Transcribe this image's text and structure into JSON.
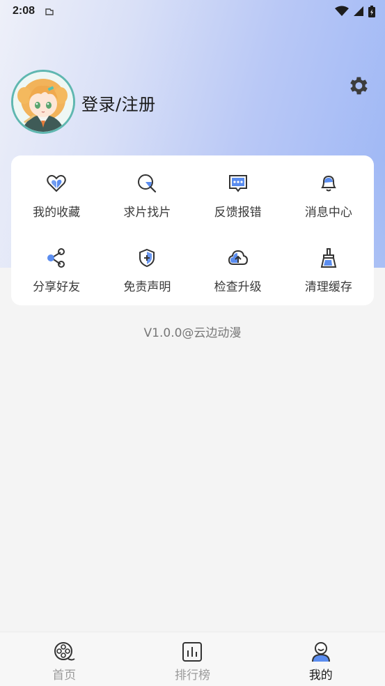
{
  "status_bar": {
    "time": "2:08"
  },
  "profile": {
    "login_label": "登录/注册"
  },
  "features": [
    {
      "label": "我的收藏",
      "icon": "heart-icon"
    },
    {
      "label": "求片找片",
      "icon": "search-film-icon"
    },
    {
      "label": "反馈报错",
      "icon": "feedback-icon"
    },
    {
      "label": "消息中心",
      "icon": "bell-icon"
    },
    {
      "label": "分享好友",
      "icon": "share-icon"
    },
    {
      "label": "免责声明",
      "icon": "shield-icon"
    },
    {
      "label": "检查升级",
      "icon": "cloud-upload-icon"
    },
    {
      "label": "清理缓存",
      "icon": "broom-icon"
    }
  ],
  "version": "V1.0.0@云边动漫",
  "tabs": [
    {
      "label": "首页",
      "icon": "film-reel-icon",
      "active": false
    },
    {
      "label": "排行榜",
      "icon": "bar-chart-icon",
      "active": false
    },
    {
      "label": "我的",
      "icon": "user-icon",
      "active": true
    }
  ],
  "colors": {
    "accent": "#5b8def",
    "hero_start": "#eef0f9",
    "hero_end": "#9cb6f5",
    "avatar_ring": "#5fb7b0"
  }
}
